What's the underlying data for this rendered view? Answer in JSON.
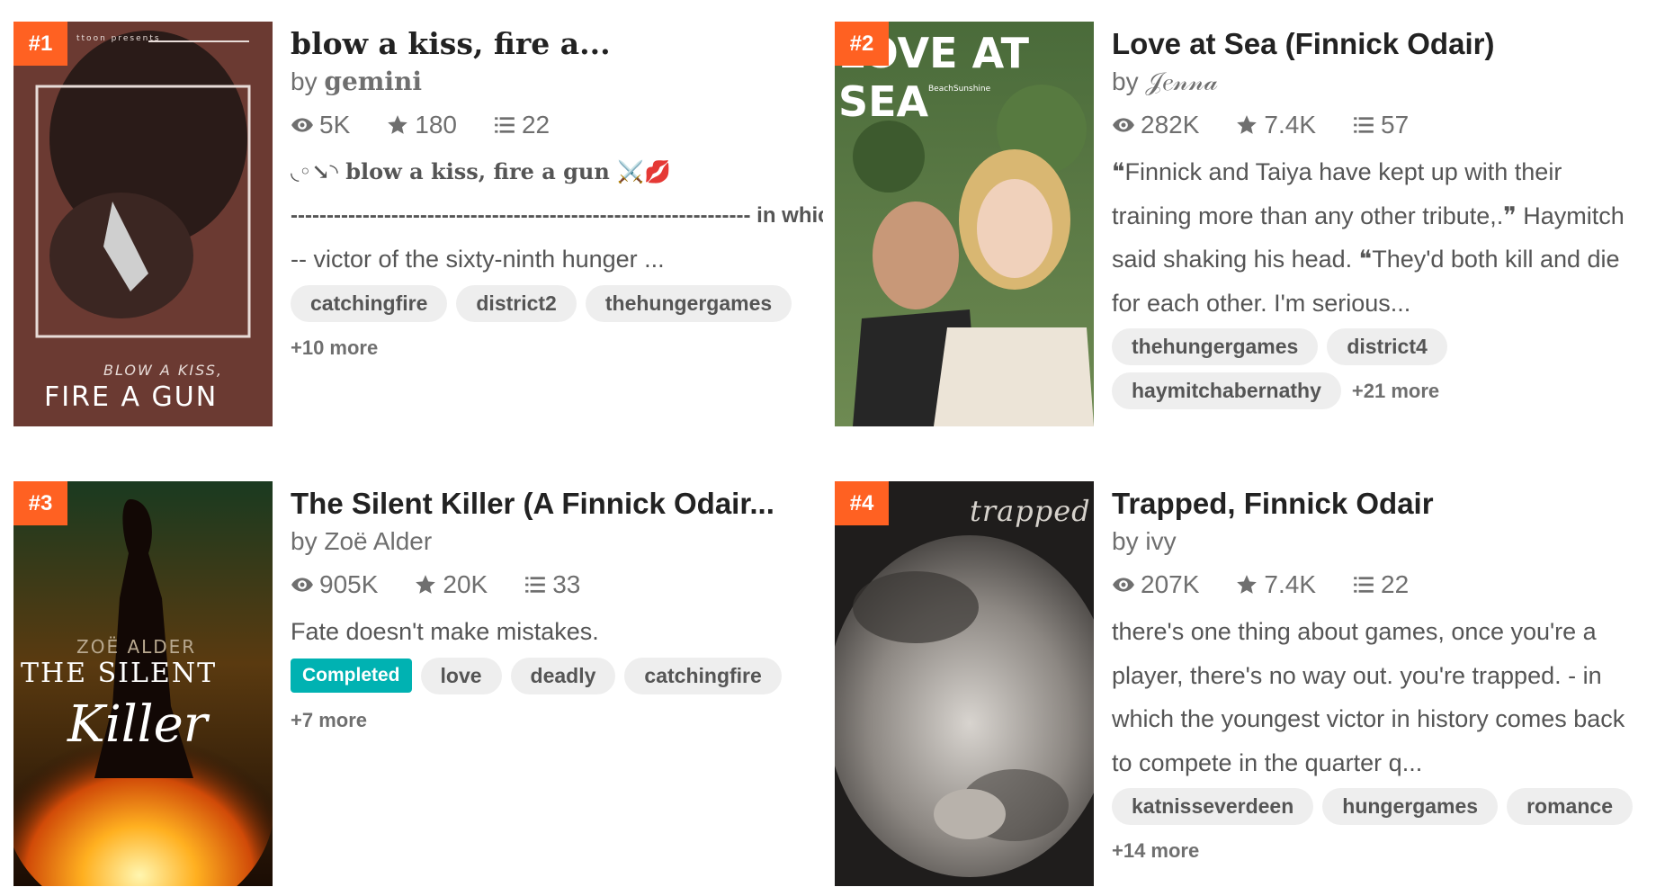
{
  "stories": [
    {
      "rank": "#1",
      "title": "blow a kiss, fire a...",
      "author_prefix": "by",
      "author": "gemini",
      "reads": "5K",
      "votes": "180",
      "parts": "22",
      "desc_line1": "◟◦↘◝ blow a kiss, fire a gun ⚔️💋",
      "desc_line2": "---------------------------------------------------------------- in which",
      "desc_line3": "-- victor of the sixty-ninth hunger ...",
      "tags": [
        "catchingfire",
        "district2",
        "thehungergames"
      ],
      "more": "+10 more",
      "cover": {
        "top_text": "ttoon presents",
        "line1": "BLOW A KISS,",
        "line2": "FIRE A GUN",
        "bg": "#6b3a32"
      }
    },
    {
      "rank": "#2",
      "title": "Love at Sea (Finnick Odair)",
      "author_prefix": "by",
      "author": "𝒥𝑒𝓃𝓃𝒶",
      "reads": "282K",
      "votes": "7.4K",
      "parts": "57",
      "description": "❝Finnick and Taiya have kept up with their training more than any other tribute,.❞ Haymitch said shaking his head. ❝They'd both kill and die for each other. I'm serious...",
      "tags": [
        "thehungergames",
        "district4",
        "haymitchabernathy"
      ],
      "more": "+21 more",
      "cover": {
        "title": "LOVE AT SEA",
        "subtitle": "BeachSunshine"
      }
    },
    {
      "rank": "#3",
      "title": "The Silent Killer (A Finnick Odair...",
      "author_prefix": "by",
      "author": "Zoë Alder",
      "reads": "905K",
      "votes": "20K",
      "parts": "33",
      "description": "Fate doesn't make mistakes.",
      "completed_label": "Completed",
      "tags": [
        "love",
        "deadly",
        "catchingfire"
      ],
      "more": "+7 more",
      "cover": {
        "author": "ZOË ALDER",
        "line1": "THE SILENT",
        "line2": "Killer"
      }
    },
    {
      "rank": "#4",
      "title": "Trapped, Finnick Odair",
      "author_prefix": "by",
      "author": "ivy",
      "reads": "207K",
      "votes": "7.4K",
      "parts": "22",
      "description": "there's one thing about games, once you're a player, there's no way out. you're trapped. - in which the youngest victor in history comes back to compete in the quarter q...",
      "tags": [
        "katnisseverdeen",
        "hungergames",
        "romance"
      ],
      "more": "+14 more",
      "cover": {
        "title": "trapped"
      }
    }
  ],
  "colors": {
    "rank_badge": "#ff6122",
    "completed_badge": "#00b2b2",
    "tag_bg": "#eeeeee"
  }
}
